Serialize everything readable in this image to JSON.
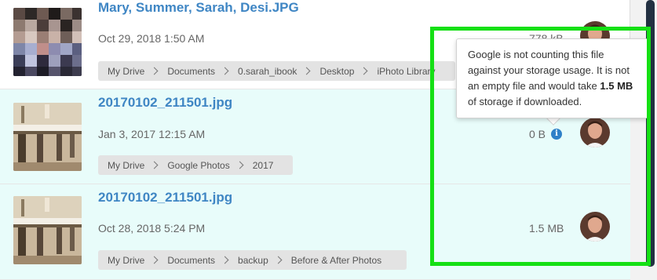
{
  "files": [
    {
      "name": "Mary, Summer, Sarah, Desi.JPG",
      "date": "Oct 29, 2018 1:50 AM",
      "size": "778 kB",
      "path": [
        "My Drive",
        "Documents",
        "0.sarah_ibook",
        "Desktop",
        "iPhoto Library"
      ]
    },
    {
      "name": "20170102_211501.jpg",
      "date": "Jan 3, 2017 12:15 AM",
      "size": "0 B",
      "path": [
        "My Drive",
        "Google Photos",
        "2017"
      ]
    },
    {
      "name": "20170102_211501.jpg",
      "date": "Oct 28, 2018 5:24 PM",
      "size": "1.5 MB",
      "path": [
        "My Drive",
        "Documents",
        "backup",
        "Before & After Photos"
      ]
    }
  ],
  "tooltip": {
    "text_before": "Google is not counting this file against your storage usage. It is not an empty file and would take ",
    "text_bold": "1.5 MB",
    "text_after": " of storage if downloaded."
  },
  "icons": {
    "info": "info-icon",
    "separator": "chevron-right-icon",
    "owner": "owner-avatar"
  },
  "colors": {
    "file_link": "#3f86c4",
    "row_highlight": "#e8fcfa",
    "annotation_box": "#15e015",
    "info_icon": "#2f80c8"
  }
}
